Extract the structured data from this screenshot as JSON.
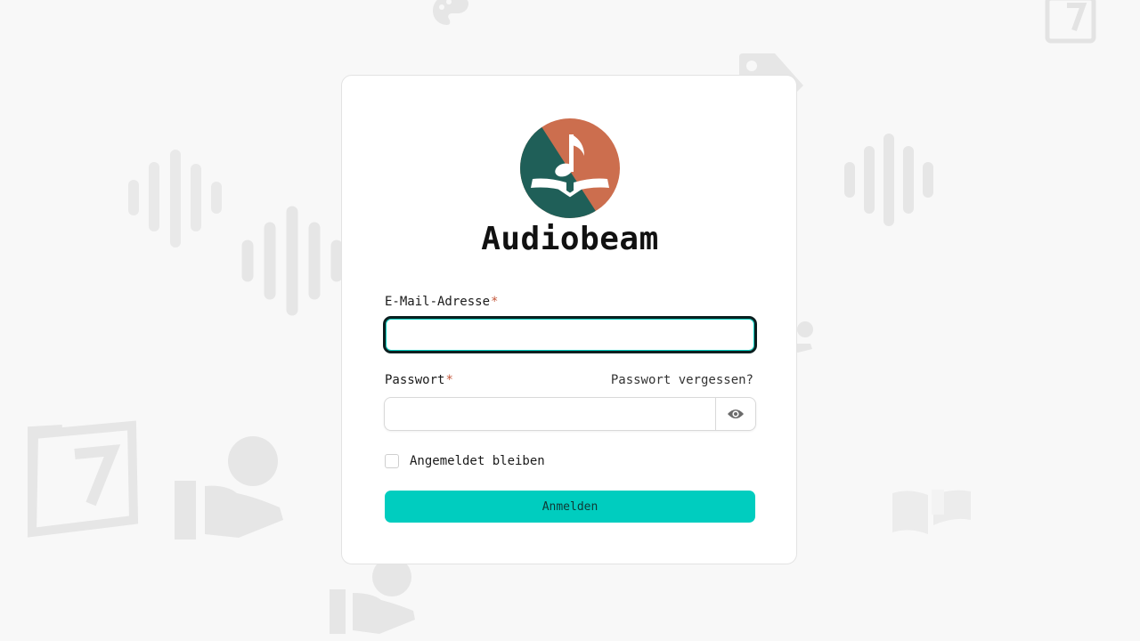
{
  "app": {
    "name": "Audiobeam"
  },
  "form": {
    "email_label": "E-Mail-Adresse",
    "email_value": "",
    "password_label": "Passwort",
    "password_value": "",
    "required_marker": "*",
    "forgot_link": "Passwort vergessen?",
    "remember_label": "Angemeldet bleiben",
    "remember_checked": false,
    "submit_label": "Anmelden"
  },
  "icons": {
    "logo": "audiobeam-logo-icon",
    "password_toggle": "eye-icon",
    "background": [
      "soundwave-icon",
      "calendar-7-icon",
      "person-reading-icon",
      "open-book-icon",
      "tag-icon",
      "palette-icon"
    ]
  },
  "colors": {
    "accent": "#00cdbf",
    "logo_green": "#1f5f58",
    "logo_orange": "#cc6e4e",
    "required": "#c4573a",
    "background": "#f8f8f8"
  }
}
